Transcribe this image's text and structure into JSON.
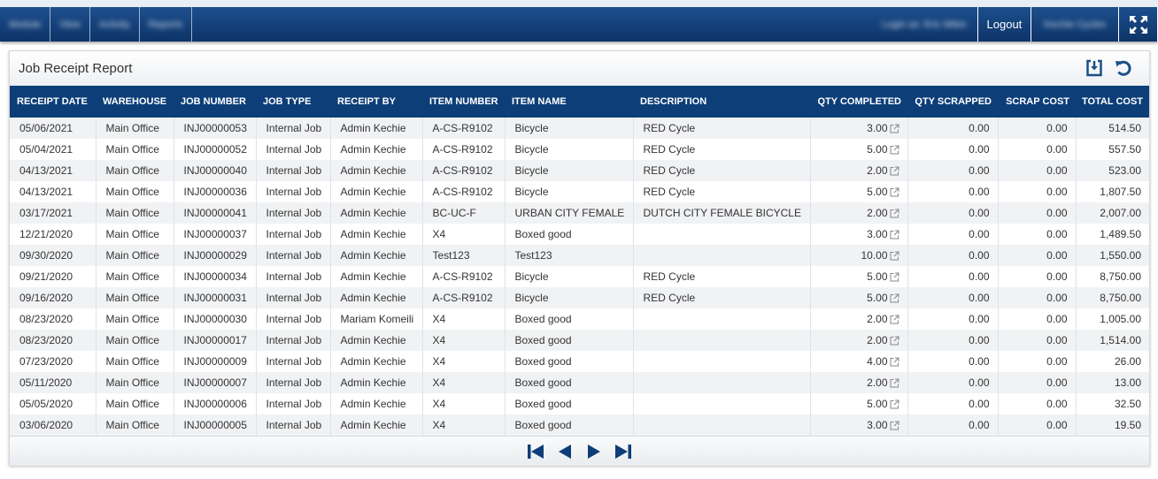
{
  "topbar": {
    "menu": [
      {
        "label": "Module"
      },
      {
        "label": "View"
      },
      {
        "label": "Activity"
      },
      {
        "label": "Reports"
      }
    ],
    "login_text": "Login as: Eric Miles",
    "logout_label": "Logout",
    "company_text": "Kechie Cycles"
  },
  "report": {
    "title": "Job Receipt Report",
    "columns": [
      "RECEIPT DATE",
      "WAREHOUSE",
      "JOB NUMBER",
      "JOB TYPE",
      "RECEIPT BY",
      "ITEM NUMBER",
      "ITEM NAME",
      "DESCRIPTION",
      "QTY COMPLETED",
      "QTY SCRAPPED",
      "SCRAP COST",
      "TOTAL COST"
    ],
    "rows": [
      [
        "05/06/2021",
        "Main Office",
        "INJ00000053",
        "Internal Job",
        "Admin Kechie",
        "A-CS-R9102",
        "Bicycle",
        "RED Cycle",
        "3.00",
        "0.00",
        "0.00",
        "514.50"
      ],
      [
        "05/04/2021",
        "Main Office",
        "INJ00000052",
        "Internal Job",
        "Admin Kechie",
        "A-CS-R9102",
        "Bicycle",
        "RED Cycle",
        "5.00",
        "0.00",
        "0.00",
        "557.50"
      ],
      [
        "04/13/2021",
        "Main Office",
        "INJ00000040",
        "Internal Job",
        "Admin Kechie",
        "A-CS-R9102",
        "Bicycle",
        "RED Cycle",
        "2.00",
        "0.00",
        "0.00",
        "523.00"
      ],
      [
        "04/13/2021",
        "Main Office",
        "INJ00000036",
        "Internal Job",
        "Admin Kechie",
        "A-CS-R9102",
        "Bicycle",
        "RED Cycle",
        "5.00",
        "0.00",
        "0.00",
        "1,807.50"
      ],
      [
        "03/17/2021",
        "Main Office",
        "INJ00000041",
        "Internal Job",
        "Admin Kechie",
        "BC-UC-F",
        "URBAN CITY FEMALE",
        "DUTCH CITY FEMALE BICYCLE",
        "2.00",
        "0.00",
        "0.00",
        "2,007.00"
      ],
      [
        "12/21/2020",
        "Main Office",
        "INJ00000037",
        "Internal Job",
        "Admin Kechie",
        "X4",
        "Boxed good",
        "",
        "3.00",
        "0.00",
        "0.00",
        "1,489.50"
      ],
      [
        "09/30/2020",
        "Main Office",
        "INJ00000029",
        "Internal Job",
        "Admin Kechie",
        "Test123",
        "Test123",
        "",
        "10.00",
        "0.00",
        "0.00",
        "1,550.00"
      ],
      [
        "09/21/2020",
        "Main Office",
        "INJ00000034",
        "Internal Job",
        "Admin Kechie",
        "A-CS-R9102",
        "Bicycle",
        "RED Cycle",
        "5.00",
        "0.00",
        "0.00",
        "8,750.00"
      ],
      [
        "09/16/2020",
        "Main Office",
        "INJ00000031",
        "Internal Job",
        "Admin Kechie",
        "A-CS-R9102",
        "Bicycle",
        "RED Cycle",
        "5.00",
        "0.00",
        "0.00",
        "8,750.00"
      ],
      [
        "08/23/2020",
        "Main Office",
        "INJ00000030",
        "Internal Job",
        "Mariam Komeili",
        "X4",
        "Boxed good",
        "",
        "2.00",
        "0.00",
        "0.00",
        "1,005.00"
      ],
      [
        "08/23/2020",
        "Main Office",
        "INJ00000017",
        "Internal Job",
        "Admin Kechie",
        "X4",
        "Boxed good",
        "",
        "2.00",
        "0.00",
        "0.00",
        "1,514.00"
      ],
      [
        "07/23/2020",
        "Main Office",
        "INJ00000009",
        "Internal Job",
        "Admin Kechie",
        "X4",
        "Boxed good",
        "",
        "4.00",
        "0.00",
        "0.00",
        "26.00"
      ],
      [
        "05/11/2020",
        "Main Office",
        "INJ00000007",
        "Internal Job",
        "Admin Kechie",
        "X4",
        "Boxed good",
        "",
        "2.00",
        "0.00",
        "0.00",
        "13.00"
      ],
      [
        "05/05/2020",
        "Main Office",
        "INJ00000006",
        "Internal Job",
        "Admin Kechie",
        "X4",
        "Boxed good",
        "",
        "5.00",
        "0.00",
        "0.00",
        "32.50"
      ],
      [
        "03/06/2020",
        "Main Office",
        "INJ00000005",
        "Internal Job",
        "Admin Kechie",
        "X4",
        "Boxed good",
        "",
        "3.00",
        "0.00",
        "0.00",
        "19.50"
      ]
    ]
  },
  "icons": {
    "export": "export-icon",
    "refresh": "refresh-icon",
    "expand": "fullscreen-icon",
    "external_link": "external-link-icon",
    "pager": [
      "first-page-icon",
      "prev-page-icon",
      "next-page-icon",
      "last-page-icon"
    ]
  },
  "colors": {
    "header_blue": "#0d3e78",
    "accent_blue": "#1a4f8a"
  }
}
